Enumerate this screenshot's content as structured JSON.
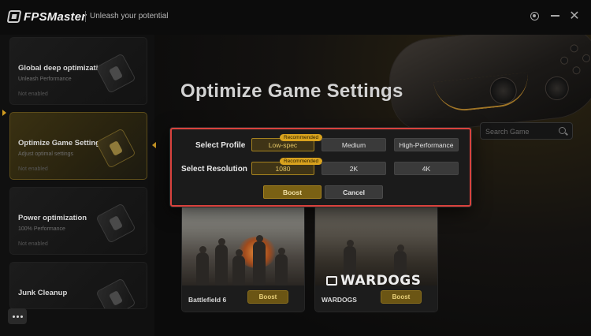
{
  "app": {
    "brand": "FPSMaster",
    "tagline": "Unleash your potential"
  },
  "sidebar": {
    "items": [
      {
        "title": "Global deep optimization",
        "subtitle": "Unleash Performance",
        "status": "Not enabled",
        "icon": "chip-icon",
        "active": false
      },
      {
        "title": "Optimize Game Settings",
        "subtitle": "Adjust optimal settings",
        "status": "Not enabled",
        "icon": "joystick-icon",
        "active": true
      },
      {
        "title": "Power optimization",
        "subtitle": "100% Performance",
        "status": "Not enabled",
        "icon": "battery-icon",
        "active": false
      },
      {
        "title": "Junk Cleanup",
        "subtitle": "",
        "status": "",
        "icon": "broom-icon",
        "active": false
      }
    ],
    "more_icon": "more-icon"
  },
  "main": {
    "page_title": "Optimize Game Settings",
    "search": {
      "placeholder": "Search Game",
      "value": ""
    },
    "games": [
      {
        "name": "Battlefield 6",
        "boost_label": "Boost"
      },
      {
        "name": "WARDOGS",
        "boost_label": "Boost",
        "logo_text": "WARDOGS"
      }
    ]
  },
  "modal": {
    "profile": {
      "label": "Select Profile",
      "options": [
        "Low-spec",
        "Medium",
        "High-Performance"
      ],
      "selected": "Low-spec",
      "badge": "Recommended"
    },
    "resolution": {
      "label": "Select Resolution",
      "options": [
        "1080",
        "2K",
        "4K"
      ],
      "selected": "1080",
      "badge": "Recommended"
    },
    "boost_label": "Boost",
    "cancel_label": "Cancel"
  },
  "colors": {
    "accent": "#d9a21e",
    "highlight_border": "#d9423d",
    "selected_text": "#e4c666"
  }
}
